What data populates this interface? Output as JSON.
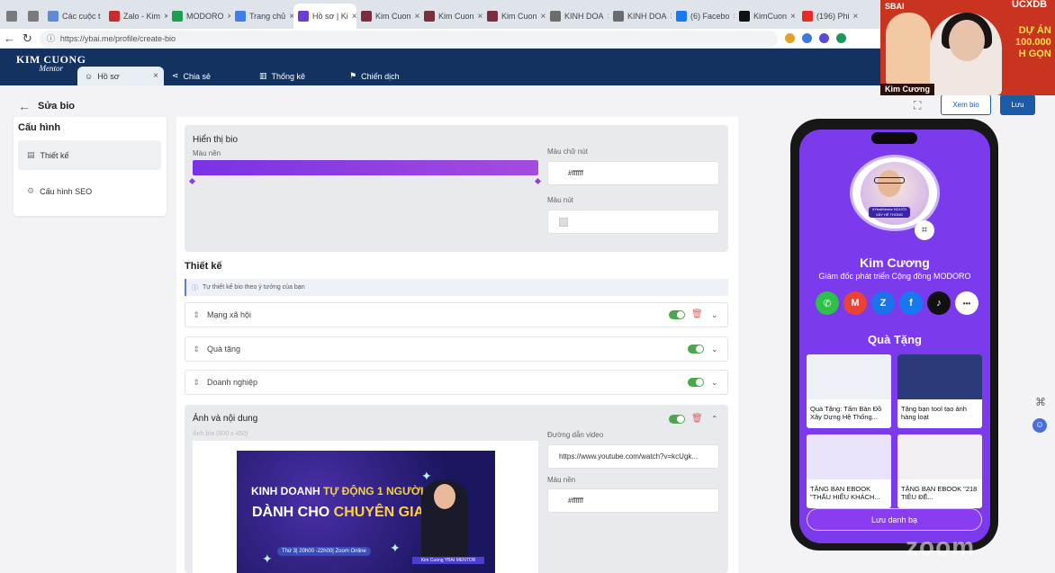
{
  "browser": {
    "tabs": [
      {
        "label": "",
        "icon": "tab-group-icon",
        "color": "#7a7a7a"
      },
      {
        "label": "",
        "icon": "window-icon",
        "color": "#7a7a7a"
      },
      {
        "label": "Các cuộc t",
        "icon": "globe-icon",
        "color": "#5f8ad6"
      },
      {
        "label": "Zalo - Kim",
        "icon": "zalo-icon",
        "color": "#c82b2b"
      },
      {
        "label": "MODORO",
        "icon": "sheets-icon",
        "color": "#1f9d55"
      },
      {
        "label": "Trang chủ",
        "icon": "chrome-icon",
        "color": "#3f7ee8"
      },
      {
        "label": "Hồ sơ | Ki",
        "icon": "site-icon",
        "color": "#6a3fd6"
      },
      {
        "label": "Kim Cuon",
        "icon": "image-icon",
        "color": "#7a2d3a"
      },
      {
        "label": "Kim Cuon",
        "icon": "image-icon",
        "color": "#7a2d3a"
      },
      {
        "label": "Kim Cuon",
        "icon": "image-icon",
        "color": "#7a2d3a"
      },
      {
        "label": "KINH DOA",
        "icon": "globe-icon",
        "color": "#6c6c6c"
      },
      {
        "label": "KINH DOA",
        "icon": "globe-icon",
        "color": "#6c6c6c"
      },
      {
        "label": "(6) Facebo",
        "icon": "facebook-icon",
        "color": "#1877f2"
      },
      {
        "label": "KimCuon",
        "icon": "tiktok-icon",
        "color": "#111111"
      },
      {
        "label": "(196) Phi",
        "icon": "youtube-icon",
        "color": "#e52d27"
      }
    ],
    "url": "https://ybai.me/profile/create-bio"
  },
  "app": {
    "logo_line1": "KIM CUONG",
    "logo_line2": "Mentor",
    "tabs": [
      {
        "label": "Hồ sơ",
        "close": "×"
      },
      {
        "label": "Chia sẻ"
      },
      {
        "label": "Thống kê"
      },
      {
        "label": "Chiến dịch"
      }
    ]
  },
  "page": {
    "back_label": "Sửa bio",
    "view_bio_label": "Xem bio",
    "save_label": "Lưu"
  },
  "sidebar": {
    "title": "Cấu hình",
    "items": [
      {
        "label": "Thiết kế"
      },
      {
        "label": "Cấu hình SEO"
      }
    ]
  },
  "display": {
    "title": "Hiển thị bio",
    "bg_label": "Màu nền",
    "bg_color": "#8a3ee0",
    "text_color_label": "Màu chữ nút",
    "text_color_value": "#ffffff",
    "button_color_label": "Màu nút"
  },
  "design": {
    "title": "Thiết kế",
    "hint": "Tự thiết kế bio theo ý tưởng của bạn",
    "rows": [
      {
        "label": "Mạng xã hội"
      },
      {
        "label": "Quà tặng"
      },
      {
        "label": "Doanh nghiệp"
      }
    ]
  },
  "media": {
    "title": "Ảnh và nội dung",
    "size_hint": "Ảnh bìa (800 x 450)",
    "video_label": "Đường dẫn video",
    "video_value": "https://www.youtube.com/watch?v=kcUgk...",
    "bg_label": "Màu nền",
    "bg_value": "#ffffff",
    "banner_line1a": "KINH DOANH",
    "banner_line1b": " TỰ ĐỘNG 1 NGƯỜI",
    "banner_line2a": "DÀNH CHO ",
    "banner_line2b": "CHUYÊN GIA",
    "banner_time": "Thứ 3| 20h00 -22h00| Zoom Online",
    "banner_caption": "Kim Cuong YBAI MENTOR"
  },
  "preview": {
    "name": "Kim Cương",
    "role": "Giám đốc phát triển Cộng đồng MODORO",
    "avatar_tag": "#YbaiMentor NGƯỜI XÂY HỆ THỐNG",
    "gifts_title": "Quà Tặng",
    "socials": [
      {
        "name": "phone-icon",
        "glyph": "✆",
        "color": "#2fbf4a"
      },
      {
        "name": "gmail-icon",
        "glyph": "M",
        "color": "#ea4335"
      },
      {
        "name": "zalo-icon",
        "glyph": "Z",
        "color": "#1a73e8"
      },
      {
        "name": "facebook-icon",
        "glyph": "f",
        "color": "#1877f2"
      },
      {
        "name": "tiktok-icon",
        "glyph": "♪",
        "color": "#111111"
      },
      {
        "name": "more-icon",
        "glyph": "•••",
        "color": "#ffffff"
      }
    ],
    "cards": [
      {
        "caption": "Quà Tặng: Tấm Bản Đồ Xây Dựng Hệ Thống...",
        "img_color": "#eef0f8"
      },
      {
        "caption": "Tặng bạn tool tạo ảnh hàng loạt",
        "img_color": "#2a3a7a"
      },
      {
        "caption": "TẶNG BẠN EBOOK \"THẤU HIỂU KHÁCH...",
        "img_color": "#e9e3fb"
      },
      {
        "caption": "TẶNG BẠN EBOOK \"218 TIÊU ĐỀ...",
        "img_color": "#f3eef2"
      }
    ],
    "save_list_label": "Lưu danh bạ"
  },
  "webcam": {
    "brand_left": "SBAI",
    "brand_right": "UCXDB",
    "promo_line1": "DỰ ÁN",
    "promo_line2": "100.000",
    "promo_line3": "H GỌN",
    "name": "Kim Cương",
    "overlay": "zoom"
  },
  "colors": {
    "header_bg": "#13325f",
    "accent": "#1a5ca8",
    "phone_bg": "#7c3aed",
    "toggle_on": "#4ca64c"
  }
}
